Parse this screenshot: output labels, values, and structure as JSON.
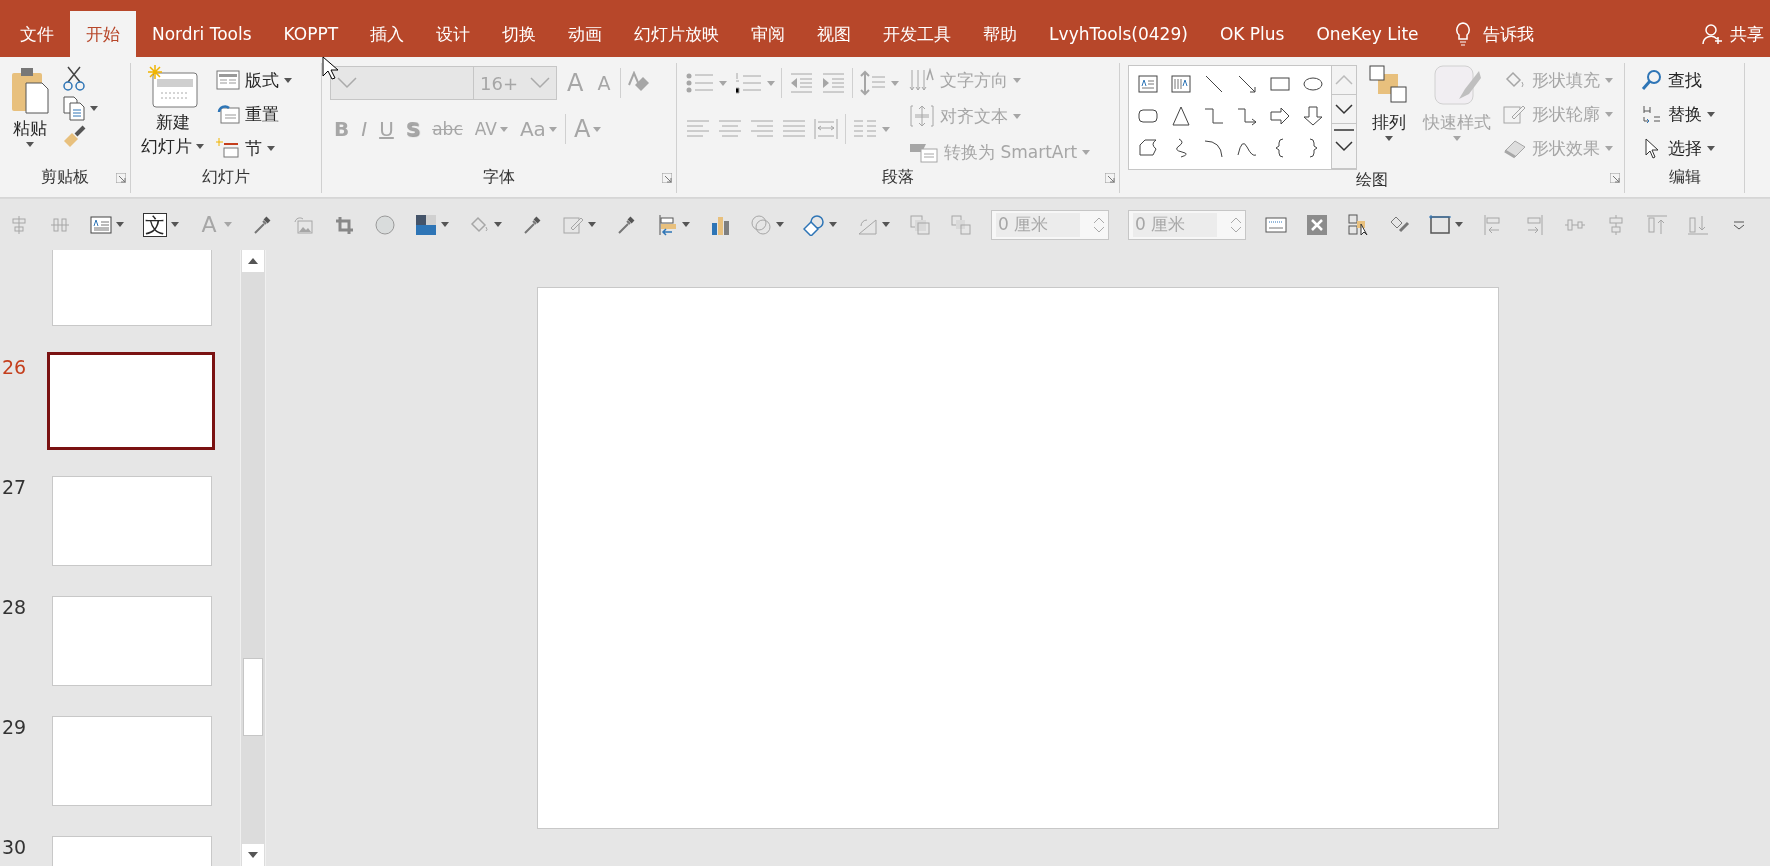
{
  "tabs": [
    {
      "label": "文件",
      "selected": false
    },
    {
      "label": "开始",
      "selected": true
    },
    {
      "label": "Nordri Tools",
      "selected": false
    },
    {
      "label": "KOPPT",
      "selected": false
    },
    {
      "label": "插入",
      "selected": false
    },
    {
      "label": "设计",
      "selected": false
    },
    {
      "label": "切换",
      "selected": false
    },
    {
      "label": "动画",
      "selected": false
    },
    {
      "label": "幻灯片放映",
      "selected": false
    },
    {
      "label": "审阅",
      "selected": false
    },
    {
      "label": "视图",
      "selected": false
    },
    {
      "label": "开发工具",
      "selected": false
    },
    {
      "label": "帮助",
      "selected": false
    },
    {
      "label": "LvyhTools(0429)",
      "selected": false
    },
    {
      "label": "OK Plus",
      "selected": false
    },
    {
      "label": "OneKey Lite",
      "selected": false
    }
  ],
  "tell_me": "告诉我",
  "share": "共享",
  "ribbon": [
    {
      "kind": "clipboard",
      "label": "剪贴板",
      "launcher": true,
      "paste": "粘贴"
    },
    {
      "kind": "slides",
      "label": "幻灯片",
      "launcher": false,
      "new_slide": [
        "新建",
        "幻灯片"
      ],
      "commands": [
        {
          "label": "版式",
          "dropdown": true
        },
        {
          "label": "重置",
          "dropdown": false
        },
        {
          "label": "节",
          "dropdown": true
        }
      ]
    },
    {
      "kind": "font",
      "label": "字体",
      "launcher": true,
      "disabled": true,
      "font_size": "16+",
      "size_buttons": [
        "A",
        "A"
      ],
      "format_buttons": [
        {
          "label": "B",
          "dropdown": false
        },
        {
          "label": "I",
          "dropdown": false
        },
        {
          "label": "U",
          "dropdown": false
        },
        {
          "label": "S",
          "dropdown": false
        },
        {
          "label": "abc",
          "dropdown": false
        },
        {
          "label": "AV",
          "dropdown": true
        },
        {
          "label": "Aa",
          "dropdown": true
        },
        {
          "label": "A",
          "dropdown": true
        }
      ]
    },
    {
      "kind": "paragraph",
      "label": "段落",
      "launcher": true,
      "disabled": true,
      "commands": [
        {
          "label": "文字方向"
        },
        {
          "label": "对齐文本"
        },
        {
          "label": "转换为 SmartArt"
        }
      ]
    },
    {
      "kind": "drawing",
      "label": "绘图",
      "launcher": true,
      "arrange": "排列",
      "quick_styles": {
        "label": "快速样式",
        "disabled": true
      },
      "commands": [
        {
          "label": "形状填充",
          "disabled": true
        },
        {
          "label": "形状轮廓",
          "disabled": true
        },
        {
          "label": "形状效果",
          "disabled": true
        }
      ]
    },
    {
      "kind": "editing",
      "label": "编辑",
      "launcher": false,
      "commands": [
        {
          "label": "查找",
          "dropdown": false
        },
        {
          "label": "替换",
          "dropdown": true
        },
        {
          "label": "选择",
          "dropdown": true
        }
      ]
    }
  ],
  "toolbar": [
    {
      "kind": "icon",
      "dropdown": false
    },
    {
      "kind": "icon",
      "dropdown": false
    },
    {
      "kind": "icon",
      "dropdown": true
    },
    {
      "kind": "glyph",
      "text": "文",
      "dropdown": true
    },
    {
      "kind": "glyph",
      "text": "A",
      "dropdown": true
    },
    {
      "kind": "icon",
      "dropdown": false
    },
    {
      "kind": "icon",
      "dropdown": false
    },
    {
      "kind": "icon",
      "dropdown": false
    },
    {
      "kind": "icon",
      "dropdown": false
    },
    {
      "kind": "icon",
      "dropdown": true
    },
    {
      "kind": "icon",
      "dropdown": true
    },
    {
      "kind": "icon",
      "dropdown": false
    },
    {
      "kind": "icon",
      "dropdown": true
    },
    {
      "kind": "icon",
      "dropdown": false
    },
    {
      "kind": "icon",
      "dropdown": true
    },
    {
      "kind": "icon",
      "dropdown": false
    },
    {
      "kind": "icon",
      "dropdown": true
    },
    {
      "kind": "icon",
      "dropdown": true
    },
    {
      "kind": "icon",
      "dropdown": true
    },
    {
      "kind": "icon",
      "dropdown": false
    },
    {
      "kind": "icon",
      "dropdown": false
    },
    {
      "kind": "field",
      "value": "0 厘米"
    },
    {
      "kind": "field",
      "value": "0 厘米"
    },
    {
      "kind": "icon",
      "dropdown": false
    },
    {
      "kind": "icon",
      "dropdown": false
    },
    {
      "kind": "icon",
      "dropdown": false
    },
    {
      "kind": "icon",
      "dropdown": false
    },
    {
      "kind": "icon",
      "dropdown": true
    },
    {
      "kind": "icon",
      "dropdown": false
    },
    {
      "kind": "icon",
      "dropdown": false
    },
    {
      "kind": "icon",
      "dropdown": false
    },
    {
      "kind": "icon",
      "dropdown": false
    },
    {
      "kind": "icon",
      "dropdown": false
    },
    {
      "kind": "icon",
      "dropdown": false
    },
    {
      "kind": "icon",
      "dropdown": false
    }
  ],
  "slides": [
    {
      "selected": false
    },
    {
      "number": "26",
      "selected": true
    },
    {
      "number": "27",
      "selected": false
    },
    {
      "number": "28",
      "selected": false
    },
    {
      "number": "29",
      "selected": false
    },
    {
      "number": "30",
      "selected": false
    }
  ]
}
